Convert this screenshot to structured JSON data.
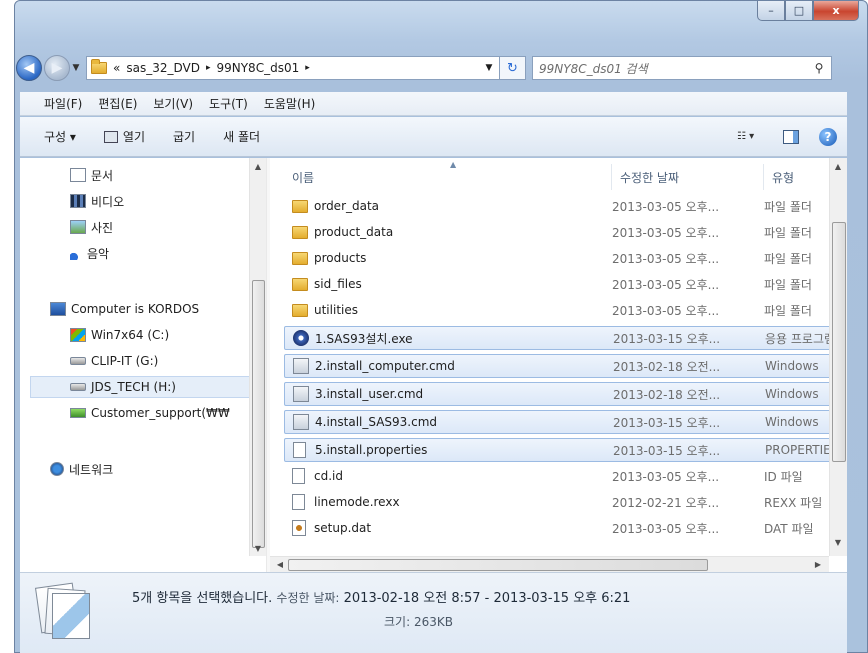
{
  "window": {
    "minimize": "–",
    "maximize": "□",
    "close": "x"
  },
  "address": {
    "overflow": "«",
    "crumbs": [
      "sas_32_DVD",
      "99NY8C_ds01"
    ],
    "separator": "▸",
    "search_placeholder": "99NY8C_ds01 검색"
  },
  "menu": [
    "파일(F)",
    "편집(E)",
    "보기(V)",
    "도구(T)",
    "도움말(H)"
  ],
  "toolbar": {
    "organize": "구성 ▾",
    "open": "열기",
    "burn": "굽기",
    "new_folder": "새 폴더"
  },
  "nav": {
    "items": [
      {
        "label": "문서",
        "icon": "document-icon"
      },
      {
        "label": "비디오",
        "icon": "video-icon"
      },
      {
        "label": "사진",
        "icon": "picture-icon"
      },
      {
        "label": "음악",
        "icon": "music-icon"
      },
      {
        "label": "Computer is KORDOS",
        "icon": "computer-icon"
      },
      {
        "label": "Win7x64 (C:)",
        "icon": "windows-drive-icon"
      },
      {
        "label": "CLIP-IT (G:)",
        "icon": "drive-icon"
      },
      {
        "label": "JDS_TECH (H:)",
        "icon": "drive-icon"
      },
      {
        "label": "Customer_support(₩₩",
        "icon": "network-drive-icon"
      },
      {
        "label": "네트워크",
        "icon": "network-icon"
      }
    ]
  },
  "columns": {
    "name": "이름",
    "date": "수정한 날짜",
    "type": "유형"
  },
  "files": [
    {
      "name": "order_data",
      "date": "2013-03-05 오후...",
      "type": "파일 폴더",
      "icon": "folder-icon",
      "selected": false
    },
    {
      "name": "product_data",
      "date": "2013-03-05 오후...",
      "type": "파일 폴더",
      "icon": "folder-icon",
      "selected": false
    },
    {
      "name": "products",
      "date": "2013-03-05 오후...",
      "type": "파일 폴더",
      "icon": "folder-icon",
      "selected": false
    },
    {
      "name": "sid_files",
      "date": "2013-03-05 오후...",
      "type": "파일 폴더",
      "icon": "folder-icon",
      "selected": false
    },
    {
      "name": "utilities",
      "date": "2013-03-05 오후...",
      "type": "파일 폴더",
      "icon": "folder-icon",
      "selected": false
    },
    {
      "name": "1.SAS93설치.exe",
      "date": "2013-03-15 오후...",
      "type": "응용 프로그램",
      "icon": "sas-exe-icon",
      "selected": true
    },
    {
      "name": "2.install_computer.cmd",
      "date": "2013-02-18 오전...",
      "type": "Windows",
      "icon": "cmd-icon",
      "selected": true
    },
    {
      "name": "3.install_user.cmd",
      "date": "2013-02-18 오전...",
      "type": "Windows",
      "icon": "cmd-icon",
      "selected": true
    },
    {
      "name": "4.install_SAS93.cmd",
      "date": "2013-03-15 오후...",
      "type": "Windows",
      "icon": "cmd-icon",
      "selected": true
    },
    {
      "name": "5.install.properties",
      "date": "2013-03-15 오후...",
      "type": "PROPERTIES",
      "icon": "text-file-icon",
      "selected": true
    },
    {
      "name": "cd.id",
      "date": "2013-03-05 오후...",
      "type": "ID 파일",
      "icon": "text-file-icon",
      "selected": false
    },
    {
      "name": "linemode.rexx",
      "date": "2012-02-21 오후...",
      "type": "REXX 파일",
      "icon": "text-file-icon",
      "selected": false
    },
    {
      "name": "setup.dat",
      "date": "2013-03-05 오후...",
      "type": "DAT 파일",
      "icon": "dat-file-icon",
      "selected": false
    }
  ],
  "details": {
    "summary": "5개 항목을 선택했습니다.",
    "date_label": "수정한 날짜:",
    "date_range": "2013-02-18 오전 8:57 - 2013-03-15 오후 6:21",
    "size_label": "크기:",
    "size": "263KB"
  }
}
